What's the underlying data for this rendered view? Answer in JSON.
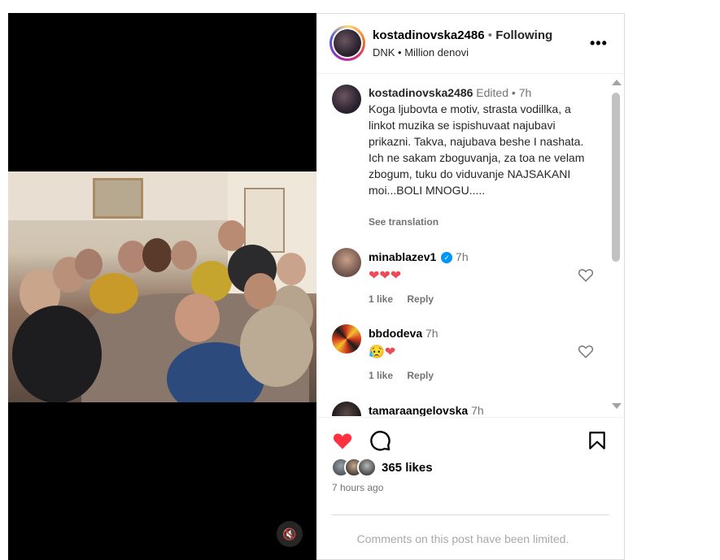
{
  "post": {
    "username": "kostadinovska2486",
    "separator": "•",
    "follow_status": "Following",
    "subtitle": "DNK • Million denovi",
    "more_label": "•••"
  },
  "caption": {
    "username": "kostadinovska2486",
    "edited": "Edited",
    "separator": "•",
    "time": "7h",
    "text": "Koga ljubovta e motiv, strasta vodillka, a linkot muzika se ispishuvaat najubavi prikazni. Takva, najubava beshe I nashata. Ich ne sakam zboguvanja, za toa ne velam zbogum, tuku do viduvanje NAJSAKANI moi...BOLI MNOGU.....",
    "see_translation": "See translation"
  },
  "comments": [
    {
      "username": "minablazev1",
      "verified": true,
      "time": "7h",
      "text": "❤❤❤",
      "likes": "1 like",
      "reply": "Reply"
    },
    {
      "username": "bbdodeva",
      "verified": false,
      "time": "7h",
      "text": "😥❤",
      "likes": "1 like",
      "reply": "Reply"
    },
    {
      "username": "tamaraangelovska",
      "verified": false,
      "time": "7h"
    }
  ],
  "stats": {
    "likes": "365 likes",
    "posted": "7 hours ago"
  },
  "footer": {
    "limited": "Comments on this post have been limited."
  },
  "media": {
    "mute_icon": "🔇"
  },
  "colors": {
    "like_red": "#ff3040",
    "verified_blue": "#0095f6",
    "muted_text": "#737373"
  }
}
